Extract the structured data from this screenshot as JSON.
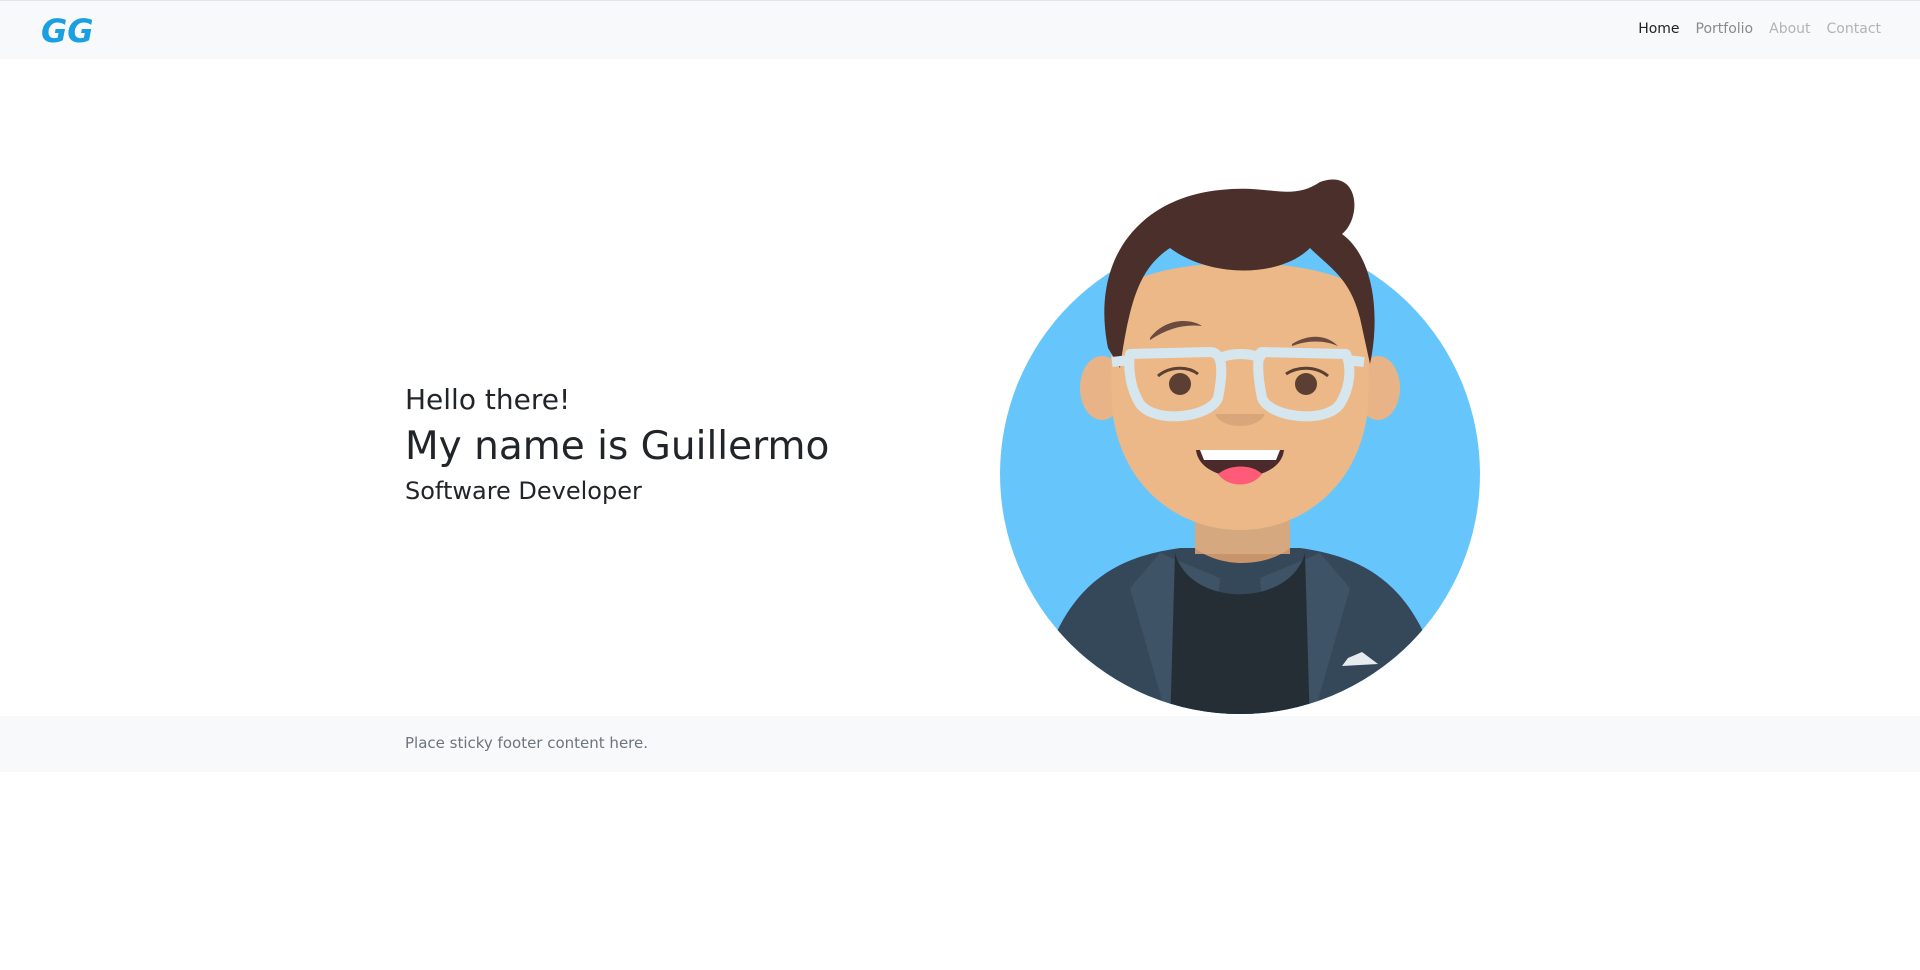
{
  "navbar": {
    "logo_text": "GG",
    "links": [
      {
        "label": "Home"
      },
      {
        "label": "Portfolio"
      },
      {
        "label": "About"
      },
      {
        "label": "Contact"
      }
    ]
  },
  "hero": {
    "greeting": "Hello there!",
    "name": "My name is Guillermo",
    "role": "Software Developer"
  },
  "footer": {
    "text": "Place sticky footer content here."
  },
  "colors": {
    "brand": "#1a9fe0",
    "avatar_background": "#66c6fc",
    "footer_background": "#f8f9fa"
  }
}
